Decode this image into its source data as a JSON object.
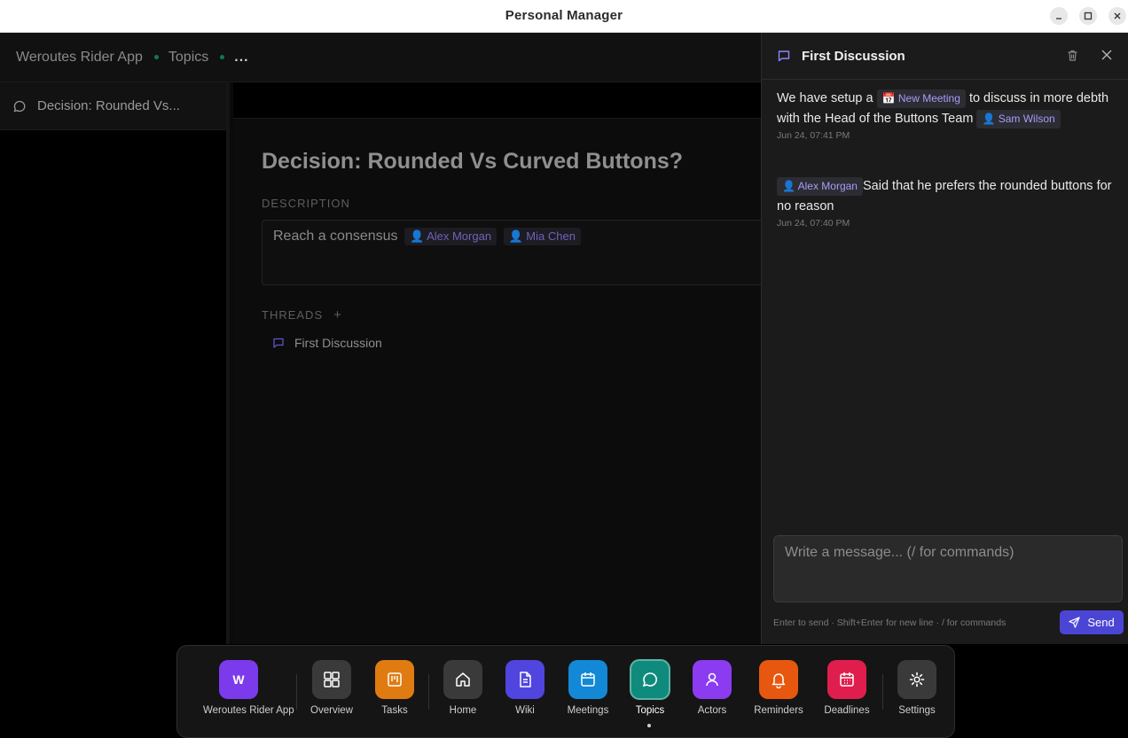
{
  "window": {
    "title": "Personal Manager"
  },
  "breadcrumb": {
    "project": "Weroutes Rider App",
    "section": "Topics",
    "more": "..."
  },
  "sidebar": {
    "items": [
      {
        "label": "Decision: Rounded Vs..."
      }
    ]
  },
  "topic": {
    "title": "Decision: Rounded Vs Curved Buttons?",
    "description_label": "DESCRIPTION",
    "description_text": "Reach a consensus",
    "description_mentions": [
      "👤 Alex Morgan",
      "👤 Mia Chen"
    ],
    "threads_label": "THREADS",
    "add_symbol": "+",
    "threads": [
      {
        "label": "First Discussion"
      }
    ]
  },
  "panel": {
    "title": "First Discussion",
    "messages": [
      {
        "text_before": "We have setup a",
        "chip": "📅 New Meeting",
        "text_after": "to discuss in more debth with the Head of the Buttons Team",
        "mention": "👤 Sam Wilson",
        "timestamp": "Jun 24, 07:41 PM"
      },
      {
        "mention": "👤 Alex Morgan",
        "text": "Said that he prefers the rounded buttons for no reason",
        "timestamp": "Jun 24, 07:40 PM"
      }
    ],
    "composer_placeholder": "Write a message... (/ for commands)",
    "hint": "Enter to send · Shift+Enter for new line · / for commands",
    "send_label": "Send"
  },
  "dock": {
    "items": [
      {
        "label": "Weroutes Rider App",
        "letter": "W",
        "color": "#7c3aed",
        "icon": "project-avatar"
      },
      {
        "label": "Overview",
        "color": "#3a3a3a",
        "icon": "grid-icon"
      },
      {
        "label": "Tasks",
        "color": "#e07b12",
        "icon": "kanban-icon"
      },
      {
        "label": "Home",
        "color": "#3a3a3a",
        "icon": "home-icon"
      },
      {
        "label": "Wiki",
        "color": "#5145e0",
        "icon": "document-icon"
      },
      {
        "label": "Meetings",
        "color": "#1388d6",
        "icon": "calendar-icon"
      },
      {
        "label": "Topics",
        "color": "#0f8b7d",
        "icon": "chat-icon",
        "active": true
      },
      {
        "label": "Actors",
        "color": "#8b3cf0",
        "icon": "person-icon"
      },
      {
        "label": "Reminders",
        "color": "#e8570f",
        "icon": "bell-icon"
      },
      {
        "label": "Deadlines",
        "color": "#e01e4e",
        "icon": "calendar-alert-icon"
      },
      {
        "label": "Settings",
        "color": "#3a3a3a",
        "icon": "gear-icon"
      }
    ]
  }
}
